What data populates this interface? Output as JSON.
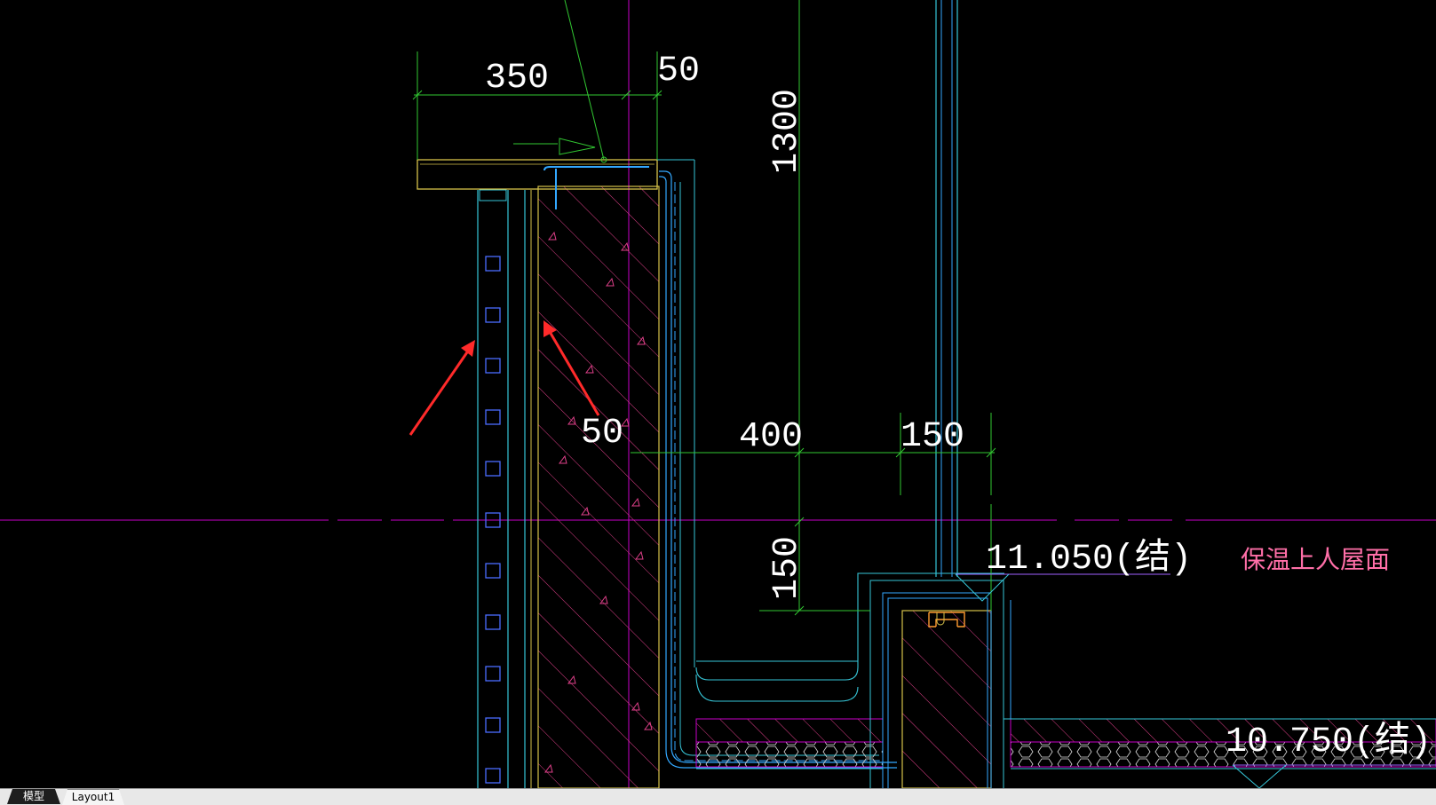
{
  "drawing": {
    "dimensions": {
      "d350": "350",
      "d50_top": "50",
      "d1300": "1300",
      "d50_mid": "50",
      "d400": "400",
      "d150_h": "150",
      "d150_v": "150"
    },
    "elevations": {
      "el_11050": "11.050(结)",
      "el_10750": "10.750(结)"
    },
    "roof_label": "保温上人屋面"
  },
  "tabs": {
    "model": "模型",
    "layout1": "Layout1"
  },
  "colors": {
    "background": "#000000",
    "dimension": "#32c832",
    "wall_outline": "#d6c24a",
    "hatch": "#e0408a",
    "waterproof": "#33a8ff",
    "frame": "#36c6d8",
    "annotation_arrow": "#ff2a2a",
    "axis": "#c800c8",
    "text_white": "#ffffff",
    "roof_label": "#ff6fa8"
  }
}
